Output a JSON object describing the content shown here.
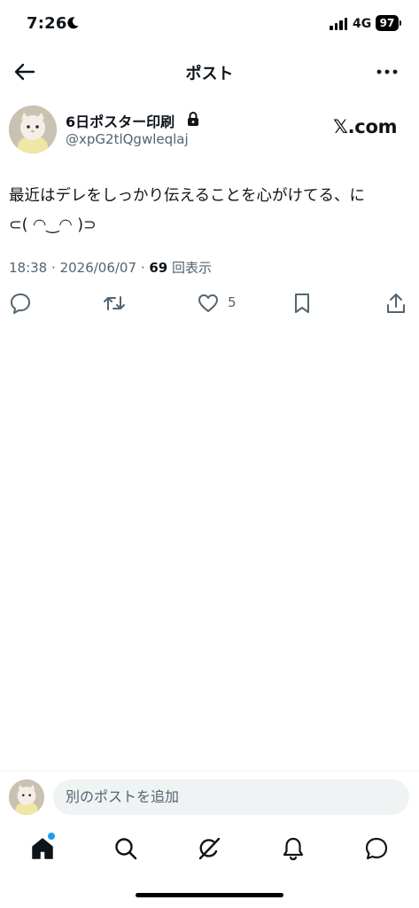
{
  "status_bar": {
    "time": "7:26",
    "network": "4G",
    "battery": "97",
    "icons": [
      "moon-icon",
      "signal-icon",
      "battery-icon"
    ]
  },
  "header": {
    "title": "ポスト",
    "icons": [
      "back-arrow-icon",
      "more-dots-icon"
    ]
  },
  "post": {
    "author_name": "6日ポスター印刷",
    "handle": "@xpG2tlQgwleqlaj",
    "source_label": "𝕏.com",
    "text_line1": "最近はデレをしっかり伝えることを心がけてる、に",
    "text_line2": "⊂( ◠‿◠ )⊃",
    "time": "18:38",
    "date": "2026/06/07",
    "views_count": "69",
    "views_label": "回表示",
    "like_count": "5",
    "icons": [
      "lock-icon",
      "reply-icon",
      "repost-icon",
      "like-icon",
      "bookmark-icon",
      "share-icon"
    ]
  },
  "reply_bar": {
    "placeholder": "別のポストを追加"
  },
  "tab_bar": {
    "items": [
      "home-icon",
      "search-icon",
      "grok-icon",
      "notifications-icon",
      "messages-icon"
    ],
    "accent": "#1d9bf0"
  },
  "colors": {
    "text": "#0f1419",
    "secondary": "#536471",
    "surface": "#eff3f4"
  }
}
